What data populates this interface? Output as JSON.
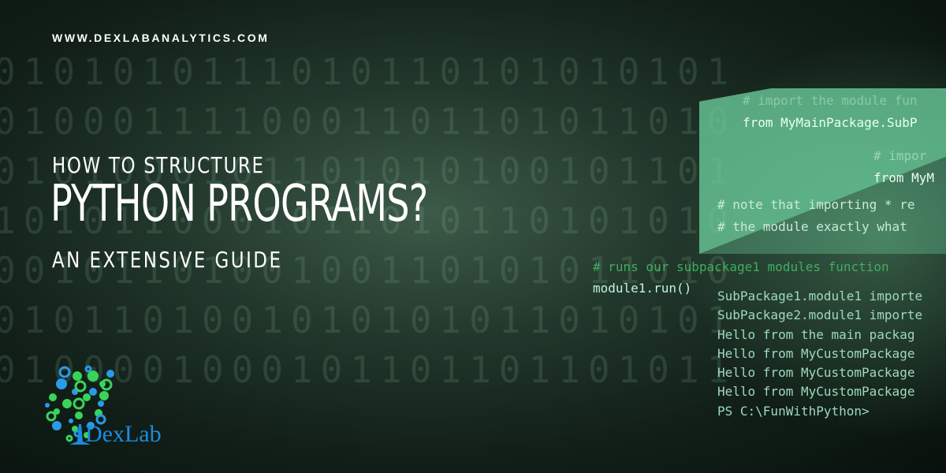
{
  "site_url": "WWW.DEXLABANALYTICS.COM",
  "title": {
    "line1": "HOW TO STRUCTURE",
    "line2": "PYTHON PROGRAMS?",
    "line3": "AN EXTENSIVE GUIDE"
  },
  "background_binary": [
    "0101010111010110101010101",
    "0100011110001101101011010",
    "0101000101101010100101101",
    "1010110001011010110101010",
    "0010110100100110101011010",
    "0101101001010101011010101",
    "0100001000101101101101011"
  ],
  "code_panel": {
    "comment1": "# import the module fun",
    "line1": "from MyMainPackage.SubP",
    "comment2": "# impor",
    "line2": "from MyM",
    "comment3": "# note that importing * re",
    "comment4": "# the module exactly what"
  },
  "code": {
    "comment": "# runs our subpackage1 modules function",
    "call": "module1.run()"
  },
  "terminal": [
    "SubPackage1.module1 importe",
    "SubPackage2.module1 importe",
    "Hello from the main packag",
    "Hello from MyCustomPackage",
    "Hello from MyCustomPackage",
    "Hello from MyCustomPackage",
    "PS C:\\FunWithPython>"
  ],
  "logo": {
    "text": "DexLab",
    "color": "#1c8be0",
    "accent": "#3ad35a"
  }
}
